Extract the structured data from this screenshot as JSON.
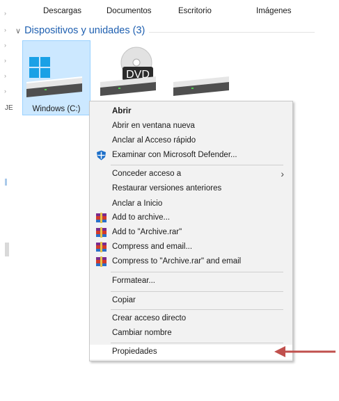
{
  "folders": [
    "Descargas",
    "Documentos",
    "Escritorio",
    "Imágenes"
  ],
  "section": {
    "title": "Dispositivos y unidades (3)",
    "chevron": "chevron-down-icon"
  },
  "left_fragment": "JE",
  "drives": [
    {
      "label": "Windows (C:)",
      "icon": "windows-drive-icon",
      "selected": true
    },
    {
      "label": "",
      "icon": "dvd-drive-icon",
      "badge": "DVD"
    },
    {
      "label": "",
      "icon": "drive-icon"
    }
  ],
  "menu": {
    "items": [
      {
        "label": "Abrir",
        "bold": true
      },
      {
        "label": "Abrir en ventana nueva"
      },
      {
        "label": "Anclar al Acceso rápido"
      },
      {
        "label": "Examinar con Microsoft Defender...",
        "icon": "defender-icon"
      },
      {
        "label": "Conceder acceso a",
        "submenu": true
      },
      {
        "label": "Restaurar versiones anteriores"
      },
      {
        "label": "Anclar a Inicio"
      },
      {
        "label": "Add to archive...",
        "icon": "winrar-icon"
      },
      {
        "label": "Add to \"Archive.rar\"",
        "icon": "winrar-icon"
      },
      {
        "label": "Compress and email...",
        "icon": "winrar-icon"
      },
      {
        "label": "Compress to \"Archive.rar\" and email",
        "icon": "winrar-icon"
      },
      {
        "label": "Formatear..."
      },
      {
        "label": "Copiar"
      },
      {
        "label": "Crear acceso directo"
      },
      {
        "label": "Cambiar nombre"
      },
      {
        "label": "Propiedades"
      }
    ]
  },
  "annotation": {
    "arrow_color": "#c0504d",
    "points_to": "Propiedades"
  },
  "colors": {
    "selection": "#cce8ff",
    "accent": "#1e5fb0",
    "menu_bg": "#f2f2f2"
  }
}
